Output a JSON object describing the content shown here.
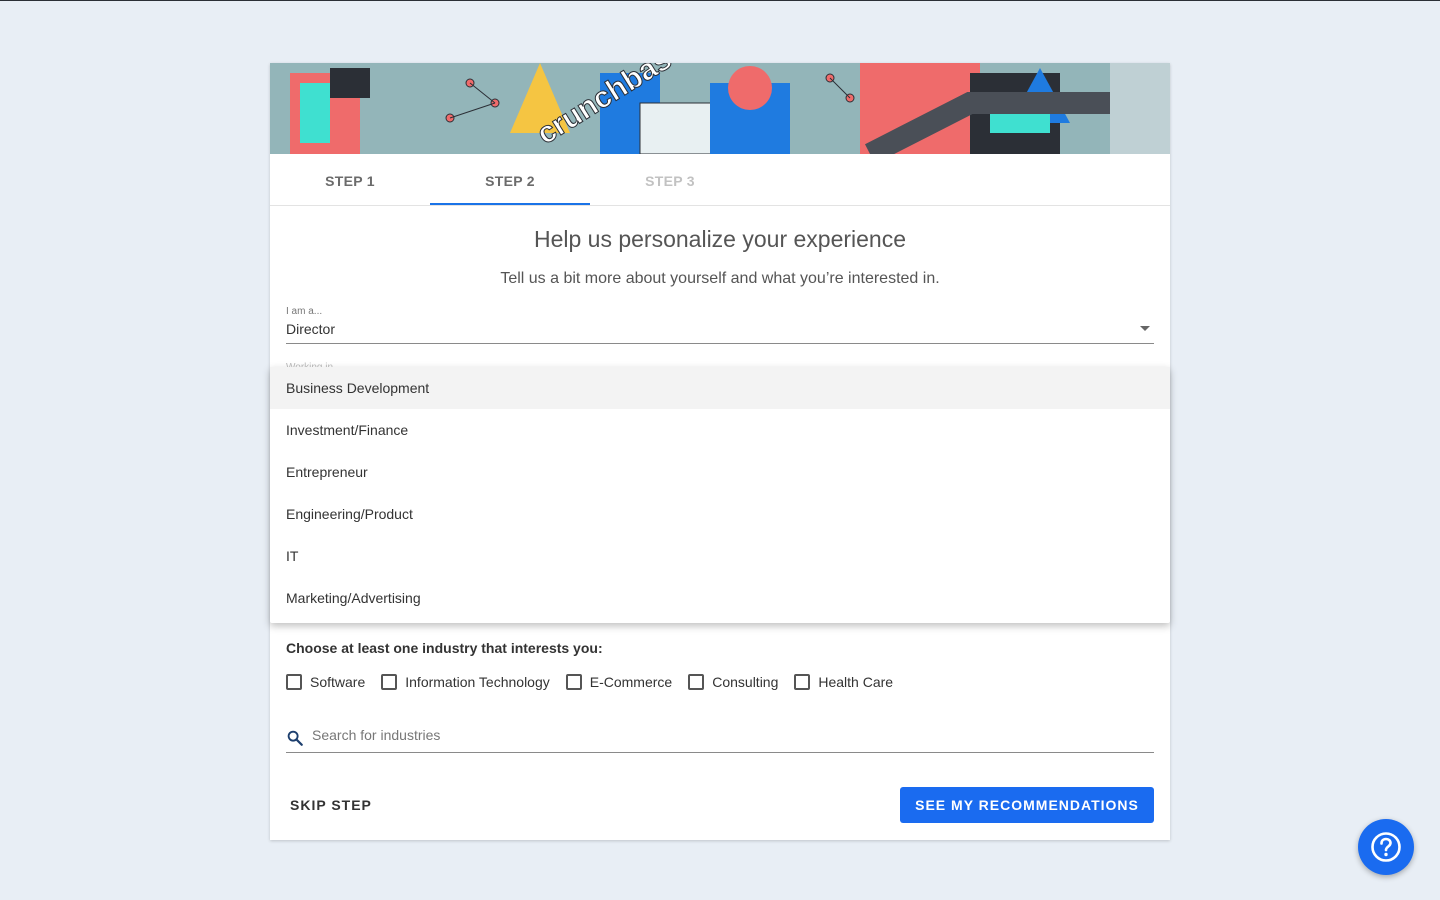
{
  "tabs": {
    "step1": "STEP 1",
    "step2": "STEP 2",
    "step3": "STEP 3"
  },
  "banner": {
    "brand_text": "crunchbase"
  },
  "heading": "Help us personalize your experience",
  "subheading": "Tell us a bit more about yourself and what you’re interested in.",
  "role_field": {
    "label": "I am a...",
    "value": "Director"
  },
  "working_field": {
    "label": "Working in"
  },
  "dropdown": {
    "options": [
      "Business Development",
      "Investment/Finance",
      "Entrepreneur",
      "Engineering/Product",
      "IT",
      "Marketing/Advertising"
    ],
    "highlighted": "Business Development"
  },
  "industries": {
    "title": "Choose at least one industry that interests you:",
    "options": [
      "Software",
      "Information Technology",
      "E-Commerce",
      "Consulting",
      "Health Care"
    ]
  },
  "search": {
    "placeholder": "Search for industries"
  },
  "buttons": {
    "skip": "SKIP STEP",
    "recommend": "SEE MY RECOMMENDATIONS"
  },
  "colors": {
    "accent": "#1a6bf0",
    "background": "#e8eef5",
    "tab_underline": "#1a73e8"
  },
  "icons": {
    "help": "question-circle-icon",
    "search": "search-icon",
    "dropdown": "caret-down-icon"
  }
}
